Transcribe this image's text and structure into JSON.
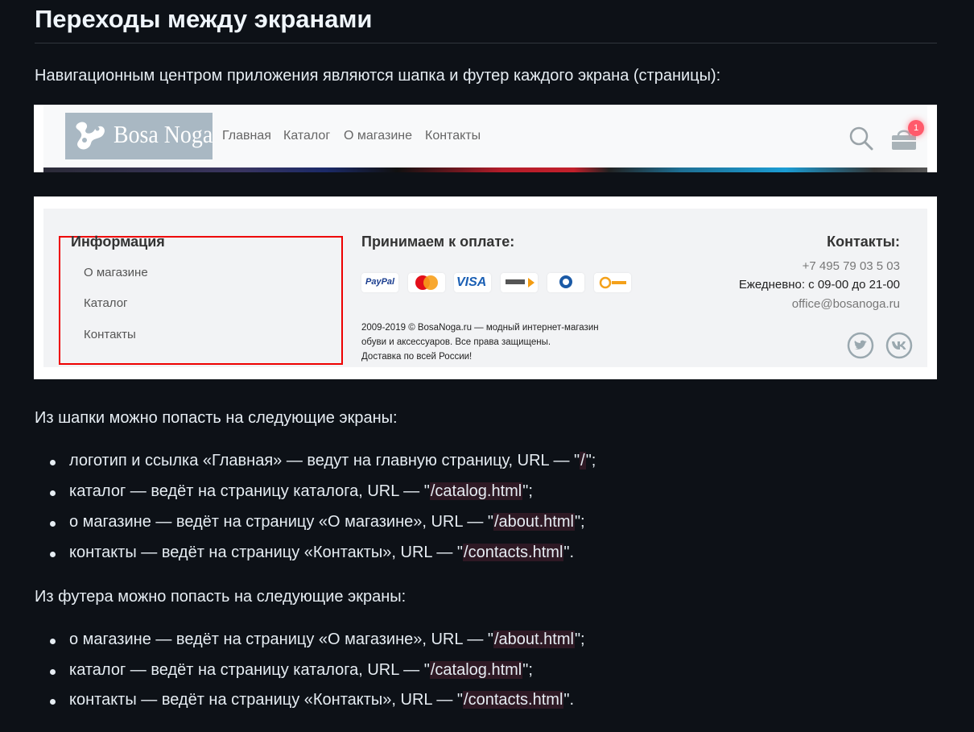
{
  "title": "Переходы между экранами",
  "intro": "Навигационным центром приложения являются шапка и футер каждого экрана (страницы):",
  "header_screenshot": {
    "logo_text": "Bosa Noga",
    "nav": [
      "Главная",
      "Каталог",
      "О магазине",
      "Контакты"
    ],
    "cart_count": "1",
    "icons": [
      "search-icon",
      "cart-icon"
    ]
  },
  "footer_screenshot": {
    "info_heading": "Информация",
    "info_links": [
      "О магазине",
      "Каталог",
      "Контакты"
    ],
    "pay_heading": "Принимаем к оплате:",
    "payment_methods": [
      "PayPal",
      "MasterCard",
      "VISA",
      "Яндекс деньги",
      "WebMoney",
      "QIWI"
    ],
    "copyright": [
      "2009-2019 © BosaNoga.ru — модный интернет-магазин",
      "обуви и аксессуаров. Все права защищены.",
      "Доставка по всей России!"
    ],
    "contacts_heading": "Контакты:",
    "phone": "+7 495 79 03 5 03",
    "hours": "Ежедневно: с 09-00 до 21-00",
    "email": "office@bosanoga.ru",
    "social": [
      "twitter-icon",
      "vk-icon"
    ],
    "highlight_color": "#e00000"
  },
  "header_section": {
    "lead": "Из шапки можно попасть на следующие экраны:",
    "items": [
      {
        "text": "логотип и ссылка «Главная» — ведут на главную страницу, URL — \"",
        "code": "/",
        "end": "\";"
      },
      {
        "text": "каталог — ведёт на страницу каталога, URL — \"",
        "code": "/catalog.html",
        "end": "\";"
      },
      {
        "text": "о магазине — ведёт на страницу «О магазине», URL — \"",
        "code": "/about.html",
        "end": "\";"
      },
      {
        "text": "контакты — ведёт на страницу «Контакты», URL — \"",
        "code": "/contacts.html",
        "end": "\"."
      }
    ]
  },
  "footer_section": {
    "lead": "Из футера можно попасть на следующие экраны:",
    "items": [
      {
        "text": "о магазине — ведёт на страницу «О магазине», URL — \"",
        "code": "/about.html",
        "end": "\";"
      },
      {
        "text": "каталог — ведёт на страницу каталога, URL — \"",
        "code": "/catalog.html",
        "end": "\";"
      },
      {
        "text": "контакты — ведёт на страницу «Контакты», URL — \"",
        "code": "/contacts.html",
        "end": "\"."
      }
    ]
  },
  "colors": {
    "background": "#0d1117",
    "text": "#e6edf3",
    "badge": "#ff5a6b"
  }
}
